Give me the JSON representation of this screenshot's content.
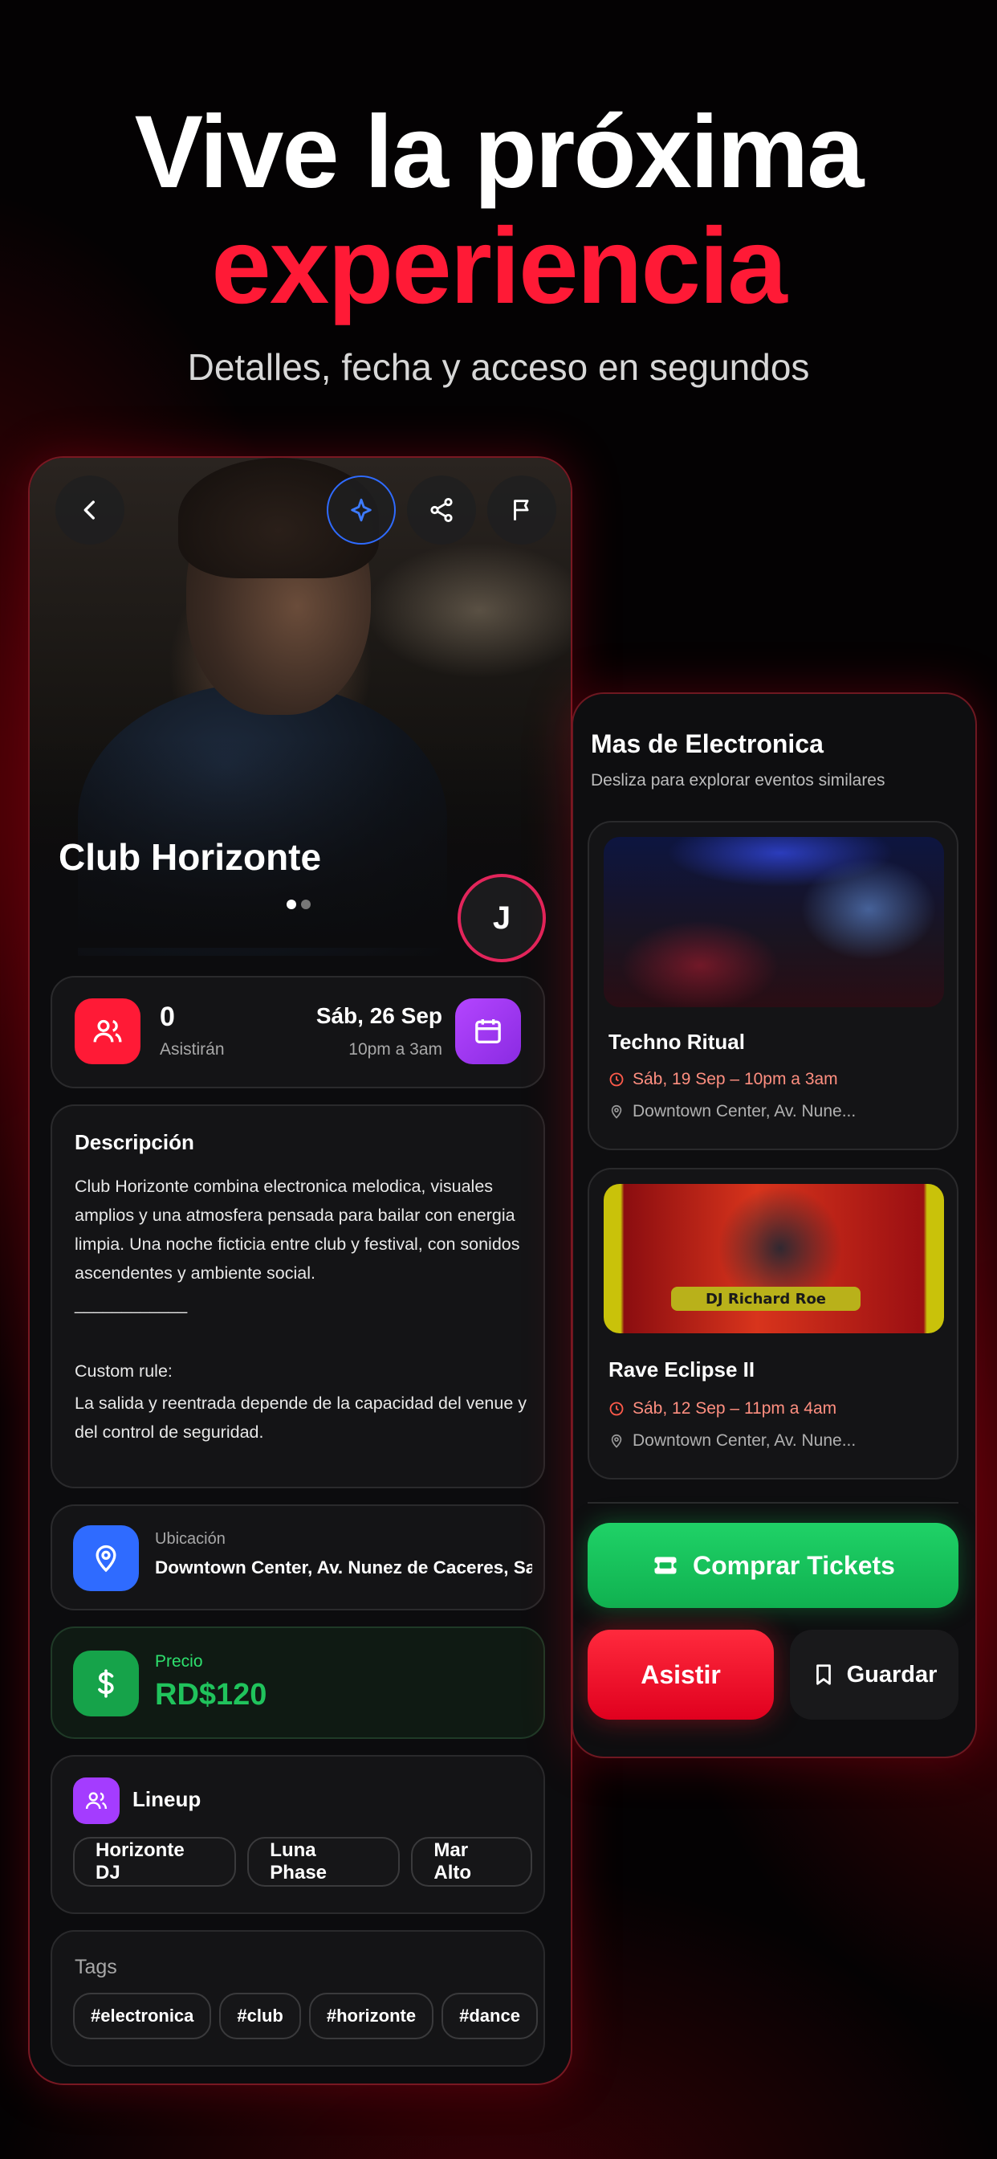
{
  "hero": {
    "line1": "Vive la próxima",
    "line2": "experiencia",
    "subtitle": "Detalles, fecha y acceso en segundos"
  },
  "event": {
    "title": "Club Horizonte",
    "avatar_initial": "J",
    "attendees_count": "0",
    "attendees_label": "Asistirán",
    "date": "Sáb, 26 Sep",
    "time": "10pm a 3am",
    "description_title": "Descripción",
    "description": "Club Horizonte combina electronica melodica, visuales amplios y una atmosfera pensada para bailar con energia limpia. Una noche ficticia entre club y festival, con sonidos ascendentes y ambiente social.",
    "divider": "____________",
    "custom_rule_label": "Custom rule:",
    "custom_rule": "La salida y reentrada depende de la capacidad del venue y del control de seguridad.",
    "location_label": "Ubicación",
    "location": "Downtown Center, Av. Nunez de Caceres, Sant...",
    "price_label": "Precio",
    "price": "RD$120",
    "lineup_title": "Lineup",
    "lineup": [
      "Horizonte DJ",
      "Luna Phase",
      "Mar Alto"
    ],
    "tags_title": "Tags",
    "tags": [
      "#electronica",
      "#club",
      "#horizonte",
      "#dance"
    ]
  },
  "icons": {
    "back": "chevron-left-icon",
    "sparkle": "sparkle-icon",
    "share": "share-icon",
    "flag": "flag-icon",
    "users": "users-icon",
    "calendar": "calendar-icon",
    "location": "map-pin-icon",
    "price": "dollar-icon",
    "lineup": "users-icon",
    "ticket": "ticket-icon",
    "bookmark": "bookmark-icon",
    "clock": "clock-icon"
  },
  "colors": {
    "accent_red": "#ff1a36",
    "green": "#16c25a",
    "blue": "#2f6bff",
    "purple": "#a43cff",
    "pink_ring": "#e2255b"
  },
  "related": {
    "title": "Mas de Electronica",
    "subtitle": "Desliza para explorar eventos similares",
    "events": [
      {
        "title": "Techno Ritual",
        "datetime": "Sáb, 19 Sep – 10pm a 3am",
        "location": "Downtown Center, Av. Nune..."
      },
      {
        "title": "Rave Eclipse II",
        "datetime": "Sáb, 12 Sep – 11pm a 4am",
        "location": "Downtown Center, Av. Nune...",
        "banner_text": "DJ Richard Roe"
      }
    ]
  },
  "actions": {
    "buy": "Comprar Tickets",
    "attend": "Asistir",
    "save": "Guardar"
  }
}
